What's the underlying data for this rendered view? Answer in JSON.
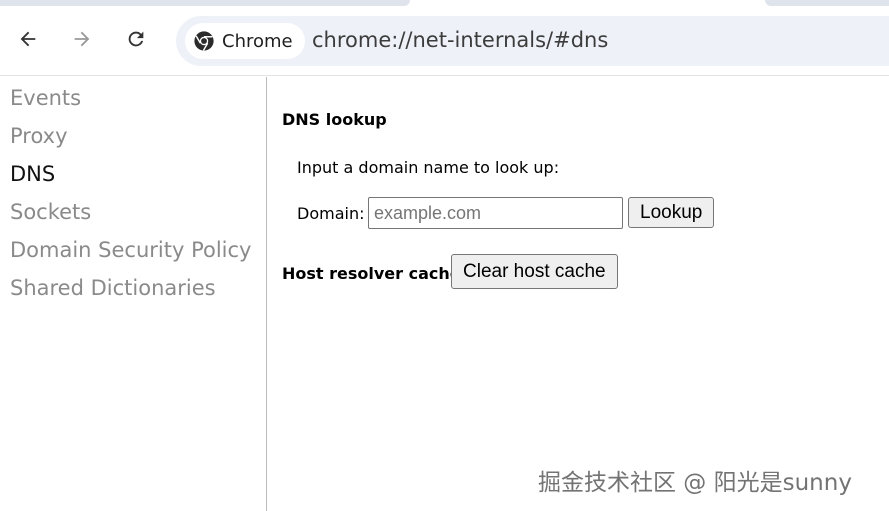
{
  "toolbar": {
    "back_icon": "arrow-left-icon",
    "forward_icon": "arrow-right-icon",
    "reload_icon": "reload-icon",
    "chip_label": "Chrome",
    "url": "chrome://net-internals/#dns"
  },
  "sidebar": {
    "items": [
      {
        "label": "Events",
        "active": false
      },
      {
        "label": "Proxy",
        "active": false
      },
      {
        "label": "DNS",
        "active": true
      },
      {
        "label": "Sockets",
        "active": false
      },
      {
        "label": "Domain Security Policy",
        "active": false
      },
      {
        "label": "Shared Dictionaries",
        "active": false
      }
    ]
  },
  "main": {
    "dns_lookup_title": "DNS lookup",
    "intro": "Input a domain name to look up:",
    "domain_label": "Domain:",
    "domain_value": "",
    "domain_placeholder": "example.com",
    "lookup_label": "Lookup",
    "host_cache_title": "Host resolver cache",
    "clear_cache_label": "Clear host cache"
  },
  "watermark": "掘金技术社区 @ 阳光是sunny",
  "colors": {
    "omnibox_bg": "#eef2f8",
    "inactive_nav": "#8a8a8a",
    "active_nav": "#111111"
  }
}
